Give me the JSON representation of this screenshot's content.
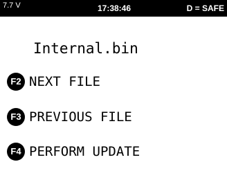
{
  "status_bar": {
    "voltage": "7.7 V",
    "time": "17:38:46",
    "mode": "D = SAFE"
  },
  "file": {
    "name": "Internal.bin"
  },
  "menu": {
    "items": [
      {
        "key": "F2",
        "label": "NEXT FILE",
        "icon": "f2-key-icon"
      },
      {
        "key": "F3",
        "label": "PREVIOUS FILE",
        "icon": "f3-key-icon"
      },
      {
        "key": "F4",
        "label": "PERFORM UPDATE",
        "icon": "f4-key-icon"
      }
    ]
  },
  "colors": {
    "background": "#ffffff",
    "status_bar": "#000000",
    "text": "#000000",
    "key_badge": "#000000"
  }
}
